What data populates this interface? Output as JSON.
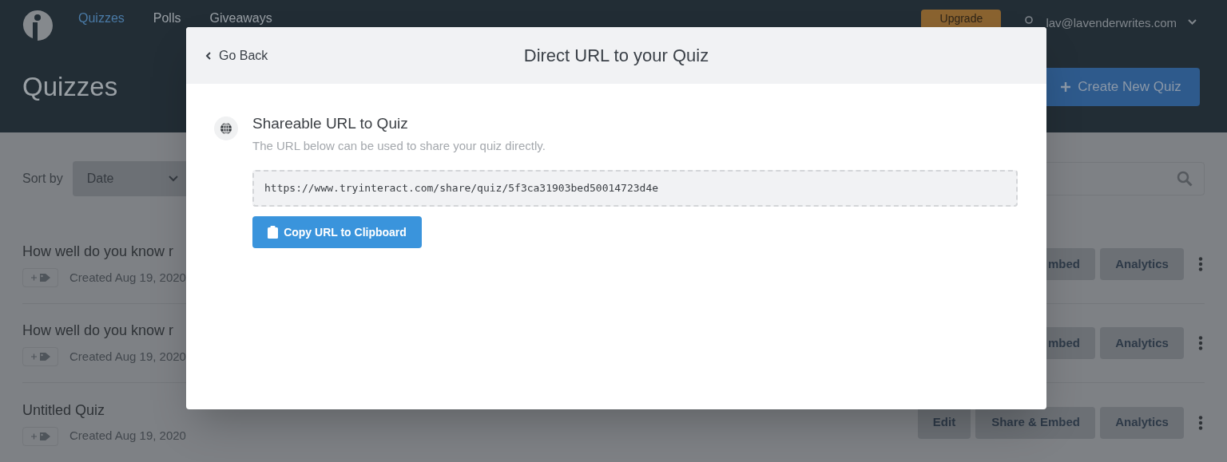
{
  "nav": {
    "items": [
      {
        "label": "Quizzes",
        "selected": true
      },
      {
        "label": "Polls",
        "selected": false
      },
      {
        "label": "Giveaways",
        "selected": false
      }
    ],
    "upgrade": "Upgrade",
    "user_email": "lav@lavenderwrites.com"
  },
  "page_title": "Quizzes",
  "create_button": "Create New Quiz",
  "sort": {
    "label": "Sort by",
    "value": "Date"
  },
  "quizzes": [
    {
      "title": "How well do you know r",
      "created": "Created Aug 19, 2020",
      "share": "mbed",
      "analytics": "Analytics"
    },
    {
      "title": "How well do you know r",
      "created": "Created Aug 19, 2020",
      "share": "mbed",
      "analytics": "Analytics"
    },
    {
      "title": "Untitled Quiz",
      "created": "Created Aug 19, 2020",
      "edit": "Edit",
      "share": "Share & Embed",
      "analytics": "Analytics"
    }
  ],
  "modal": {
    "back": "Go Back",
    "title": "Direct URL to your Quiz",
    "section_title": "Shareable URL to Quiz",
    "section_desc": "The URL below can be used to share your quiz directly.",
    "url": "https://www.tryinteract.com/share/quiz/5f3ca31903bed50014723d4e",
    "copy_button": "Copy URL to Clipboard"
  }
}
